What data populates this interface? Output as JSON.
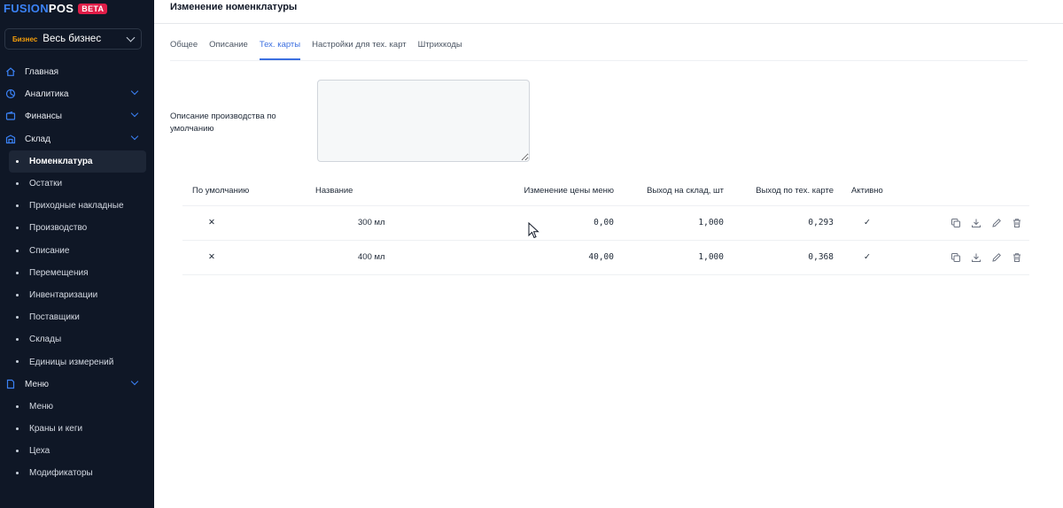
{
  "brand": {
    "name_part1": "FUSION",
    "name_part2": "POS",
    "badge": "BETA"
  },
  "business_select": {
    "tag": "Бизнес",
    "value": "Весь бизнес"
  },
  "sidebar": {
    "sections": [
      {
        "label": "Главная",
        "icon": "home-icon"
      },
      {
        "label": "Аналитика",
        "icon": "analytics-icon"
      },
      {
        "label": "Финансы",
        "icon": "wallet-icon"
      },
      {
        "label": "Склад",
        "icon": "warehouse-icon"
      }
    ],
    "sklad_items": [
      "Номенклатура",
      "Остатки",
      "Приходные накладные",
      "Производство",
      "Списание",
      "Перемещения",
      "Инвентаризации",
      "Поставщики",
      "Склады",
      "Единицы измерений"
    ],
    "menu_section": {
      "label": "Меню",
      "icon": "document-icon"
    },
    "menu_items": [
      "Меню",
      "Краны и кеги",
      "Цеха",
      "Модификаторы"
    ]
  },
  "page": {
    "title": "Изменение номенклатуры",
    "tabs": [
      "Общее",
      "Описание",
      "Тех. карты",
      "Настройки для тех. карт",
      "Штрихкоды"
    ],
    "active_tab": "Тех. карты",
    "production_description_label": "Описание производства по умолчанию",
    "production_description_value": ""
  },
  "table": {
    "headers": [
      "По умолчанию",
      "Название",
      "Изменение цены меню",
      "Выход на склад, шт",
      "Выход по тех. карте",
      "Активно"
    ],
    "rows": [
      {
        "default": "✕",
        "name": "300 мл",
        "price_change": "0,00",
        "warehouse_out": "1,000",
        "techcard_out": "0,293",
        "active": "✓"
      },
      {
        "default": "✕",
        "name": "400 мл",
        "price_change": "40,00",
        "warehouse_out": "1,000",
        "techcard_out": "0,368",
        "active": "✓"
      }
    ]
  },
  "colors": {
    "sidebar_bg": "#0f1726",
    "accent": "#3b6fe0",
    "brand_blue": "#3b82f6",
    "beta_badge": "#e11d48",
    "business_tag": "#f59e0b",
    "active_check": "#22a06b"
  }
}
